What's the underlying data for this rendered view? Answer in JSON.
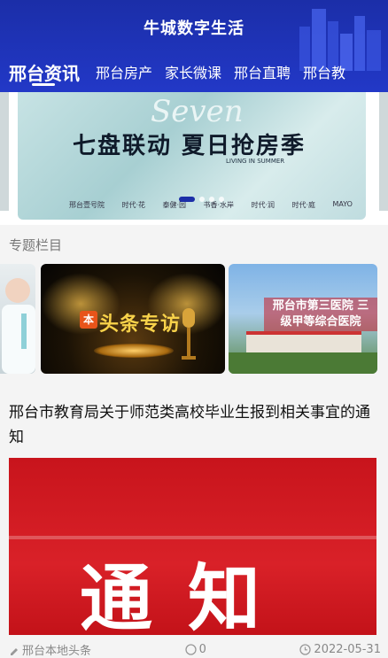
{
  "header": {
    "app_title": "牛城数字生活"
  },
  "tabs": [
    {
      "label": "邢台资讯",
      "active": true
    },
    {
      "label": "邢台房产"
    },
    {
      "label": "家长微课"
    },
    {
      "label": "邢台直聘"
    },
    {
      "label": "邢台教"
    }
  ],
  "banner": {
    "script_text": "Seven",
    "headline": "七盘联动 夏日抢房季",
    "sub": "LIVING IN SUMMER",
    "logos": [
      "邢台壹号院",
      "时代·花",
      "泰健·园",
      "书香·水岸",
      "时代·润",
      "时代·庭",
      "MAYO"
    ],
    "slide_count": 4,
    "active_slide": 0
  },
  "special": {
    "section_title": "专题栏目",
    "cards": [
      {
        "name": "health"
      },
      {
        "name": "headline",
        "icon_text": "本",
        "title": "头条专访"
      },
      {
        "name": "hospital",
        "title": "邢台市第三医院 三级甲等综合医院"
      }
    ]
  },
  "article": {
    "title": "邢台市教育局关于师范类高校毕业生报到相关事宜的通知",
    "image_text": "通知",
    "source": "邢台本地头条",
    "comments": "0",
    "date": "2022-05-31"
  },
  "colors": {
    "header": "#2238c7",
    "accent": "#1b2ea8",
    "notice_red": "#d92128"
  }
}
